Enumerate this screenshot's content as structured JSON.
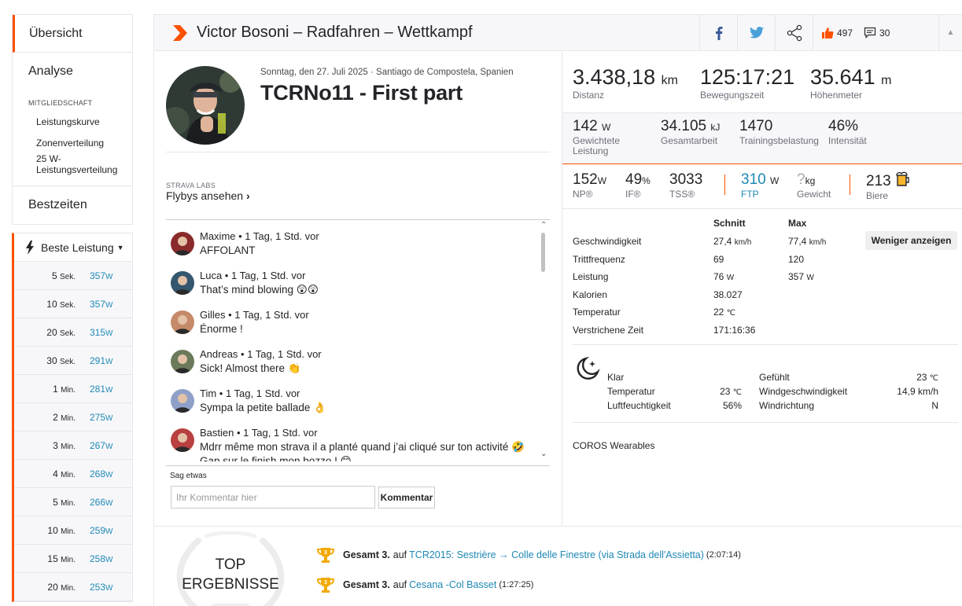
{
  "sidebar": {
    "overview": "Übersicht",
    "analysis": "Analyse",
    "membership_label": "MITGLIEDSCHAFT",
    "sub_items": [
      "Leistungskurve",
      "Zonenverteilung",
      "25 W-Leistungsverteilung"
    ],
    "best_efforts": "Bestzeiten",
    "best_power": {
      "title": "Beste Leistung",
      "rows": [
        {
          "dur": "5",
          "unit": "Sek.",
          "val": "357",
          "vunit": "W"
        },
        {
          "dur": "10",
          "unit": "Sek.",
          "val": "357",
          "vunit": "W"
        },
        {
          "dur": "20",
          "unit": "Sek.",
          "val": "315",
          "vunit": "W"
        },
        {
          "dur": "30",
          "unit": "Sek.",
          "val": "291",
          "vunit": "W"
        },
        {
          "dur": "1",
          "unit": "Min.",
          "val": "281",
          "vunit": "W"
        },
        {
          "dur": "2",
          "unit": "Min.",
          "val": "275",
          "vunit": "W"
        },
        {
          "dur": "3",
          "unit": "Min.",
          "val": "267",
          "vunit": "W"
        },
        {
          "dur": "4",
          "unit": "Min.",
          "val": "268",
          "vunit": "W"
        },
        {
          "dur": "5",
          "unit": "Min.",
          "val": "266",
          "vunit": "W"
        },
        {
          "dur": "10",
          "unit": "Min.",
          "val": "259",
          "vunit": "W"
        },
        {
          "dur": "15",
          "unit": "Min.",
          "val": "258",
          "vunit": "W"
        },
        {
          "dur": "20",
          "unit": "Min.",
          "val": "253",
          "vunit": "W"
        }
      ]
    }
  },
  "header": {
    "title": "Victor Bosoni – Radfahren – Wettkampf",
    "kudos": "497",
    "comments": "30"
  },
  "activity": {
    "date_location": "Sonntag, den 27. Juli 2025 · Santiago de Compostela, Spanien",
    "title": "TCRNo11 - First part",
    "labs_label": "STRAVA LABS",
    "flyby": "Flybys ansehen"
  },
  "comments": [
    {
      "meta": "Maxime • 1 Tag, 1 Std. vor",
      "text": "AFFOLANT",
      "color": "#8a2b2b"
    },
    {
      "meta": "Luca • 1 Tag, 1 Std. vor",
      "text": "That’s mind blowing 😲😲",
      "color": "#34566e"
    },
    {
      "meta": "Gilles • 1 Tag, 1 Std. vor",
      "text": "Énorme !",
      "color": "#c58a6a"
    },
    {
      "meta": "Andreas • 1 Tag, 1 Std. vor",
      "text": "Sick! Almost there 👏",
      "color": "#6b7a5a"
    },
    {
      "meta": "Tim • 1 Tag, 1 Std. vor",
      "text": "Sympa la petite ballade 👌",
      "color": "#8fa0c8"
    },
    {
      "meta": "Bastien • 1 Tag, 1 Std. vor",
      "text": "Mdrr même mon strava il a planté quand j’ai cliqué sur ton activité 🤣",
      "text2": "Gap sur le finish mon bozzo ! 😊",
      "color": "#b84040"
    }
  ],
  "comment_form": {
    "label": "Sag etwas",
    "placeholder": "Ihr Kommentar hier",
    "button": "Kommentar"
  },
  "stats": {
    "distance": {
      "v": "3.438,18",
      "u": "km",
      "l": "Distanz"
    },
    "moving_time": {
      "v": "125:17:21",
      "l": "Bewegungszeit"
    },
    "elevation": {
      "v": "35.641",
      "u": "m",
      "l": "Höhenmeter"
    },
    "weighted_power": {
      "v": "142",
      "u": "W",
      "l": "Gewichtete Leistung"
    },
    "work": {
      "v": "34.105",
      "u": "kJ",
      "l": "Gesamtarbeit"
    },
    "training_load": {
      "v": "1470",
      "l": "Trainingsbelastung"
    },
    "intensity": {
      "v": "46%",
      "l": "Intensität"
    },
    "np": {
      "v": "152",
      "u": "W",
      "l": "NP®"
    },
    "if": {
      "v": "49",
      "u": "%",
      "l": "IF®"
    },
    "tss": {
      "v": "3033",
      "l": "TSS®"
    },
    "ftp": {
      "v": "310",
      "u": "W",
      "l": "FTP"
    },
    "weight": {
      "v": "?",
      "u": "kg",
      "l": "Gewicht"
    },
    "beers": {
      "v": "213",
      "l": "Biere"
    }
  },
  "details": {
    "col_avg": "Schnitt",
    "col_max": "Max",
    "less_button": "Weniger anzeigen",
    "rows": [
      {
        "k": "Geschwindigkeit",
        "avg": "27,4",
        "avg_u": "km/h",
        "max": "77,4",
        "max_u": "km/h"
      },
      {
        "k": "Trittfrequenz",
        "avg": "69",
        "avg_u": "",
        "max": "120",
        "max_u": ""
      },
      {
        "k": "Leistung",
        "avg": "76",
        "avg_u": "W",
        "max": "357",
        "max_u": "W"
      },
      {
        "k": "Kalorien",
        "avg": "38.027",
        "avg_u": "",
        "max": "",
        "max_u": ""
      },
      {
        "k": "Temperatur",
        "avg": "22",
        "avg_u": "℃",
        "max": "",
        "max_u": ""
      },
      {
        "k": "Verstrichene Zeit",
        "avg": "171:16:36",
        "avg_u": "",
        "max": "",
        "max_u": ""
      }
    ]
  },
  "weather": {
    "condition": "Klar",
    "temp_label": "Temperatur",
    "temp": "23",
    "temp_u": "℃",
    "humidity_label": "Luftfeuchtigkeit",
    "humidity": "56%",
    "feels_label": "Gefühlt",
    "feels": "23",
    "feels_u": "℃",
    "wind_speed_label": "Windgeschwindigkeit",
    "wind_speed": "14,9 km/h",
    "wind_dir_label": "Windrichtung",
    "wind_dir": "N"
  },
  "device": "COROS Wearables",
  "top_results": {
    "label1": "TOP",
    "label2": "ERGEBNISSE",
    "items": [
      {
        "rank": "Gesamt 3.",
        "on": "auf",
        "segment": "TCR2015: Sestrière → Colle delle Finestre (via Strada dell'Assietta)",
        "time": "(2:07:14)"
      },
      {
        "rank": "Gesamt 3.",
        "on": "auf",
        "segment": "Cesana -Col Basset",
        "time": "(1:27:25)"
      }
    ]
  },
  "colors": {
    "accent": "#fc5200",
    "link": "#1e88b4",
    "gold": "#f2a900"
  }
}
